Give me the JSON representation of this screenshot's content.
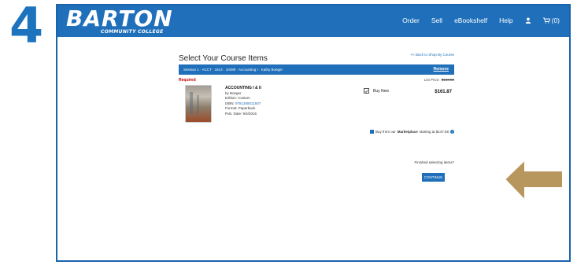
{
  "step": {
    "number": "4"
  },
  "header": {
    "logo_main": "BARTON",
    "logo_sub": "COMMUNITY COLLEGE",
    "nav": [
      "Order",
      "Sell",
      "eBookshelf",
      "Help"
    ],
    "cart_count": "(0)"
  },
  "page": {
    "title": "Select Your Course Items",
    "back_link": "<< Back to Shop By Course"
  },
  "session": {
    "label": "Session 1 · ACCT · 1614 · 10499 · Accounting I · Kathy Boeger",
    "remove_label": "Remove"
  },
  "item": {
    "required_label": "Required",
    "list_price_label": "List Price:",
    "list_price_value": "$163.50",
    "title": "ACCOUNTING I & II",
    "author": "by Boeger",
    "edition": "Edition: Custom",
    "isbn_label": "ISBN:",
    "isbn_value": "9781308011507",
    "format": "Format: Paperback",
    "pub_date": "Pub. Date: 9/4/2016",
    "option_label": "Buy New",
    "price": "$161.87"
  },
  "marketplace": {
    "text_prefix": "Buy from our",
    "text_bold": "Marketplace",
    "text_suffix": "starting at $147.68"
  },
  "footer": {
    "finished_text": "Finished selecting items?",
    "continue_label": "CONTINUE"
  },
  "colors": {
    "brand_blue": "#1f6fba",
    "arrow_gold": "#b8975e",
    "required_red": "#c00000"
  }
}
